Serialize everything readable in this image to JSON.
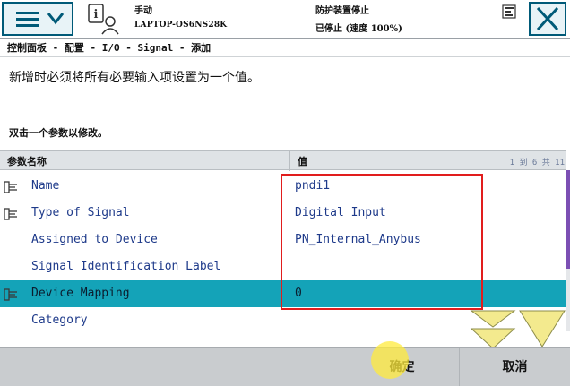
{
  "header": {
    "mode": "手动",
    "host": "LAPTOP-OS6NS28K",
    "safety": "防护装置停止",
    "run_status": "已停止 (速度 100%)"
  },
  "breadcrumb": "控制面板 - 配置 - I/O - Signal - 添加",
  "instruction": "新增时必须将所有必要输入项设置为一个值。",
  "subinstruction": "双击一个参数以修改。",
  "table": {
    "columns": {
      "name": "参数名称",
      "value": "值"
    },
    "page_info": "1 到 6 共 11",
    "rows": [
      {
        "name": "Name",
        "value": "pndi1",
        "icon": "required-param-icon",
        "selected": false
      },
      {
        "name": "Type of Signal",
        "value": "Digital Input",
        "icon": "required-param-icon",
        "selected": false
      },
      {
        "name": "Assigned to Device",
        "value": "PN_Internal_Anybus",
        "icon": "",
        "selected": false
      },
      {
        "name": "Signal Identification Label",
        "value": "",
        "icon": "",
        "selected": false
      },
      {
        "name": "Device Mapping",
        "value": "0",
        "icon": "required-param-icon",
        "selected": true
      },
      {
        "name": "Category",
        "value": "",
        "icon": "",
        "selected": false
      }
    ]
  },
  "footer": {
    "confirm_label": "确定",
    "cancel_label": "取消"
  },
  "colors": {
    "selected_row": "#14a3b8",
    "annotation_box": "#e11d1d",
    "scroll_thumb": "#7b4fb3"
  }
}
